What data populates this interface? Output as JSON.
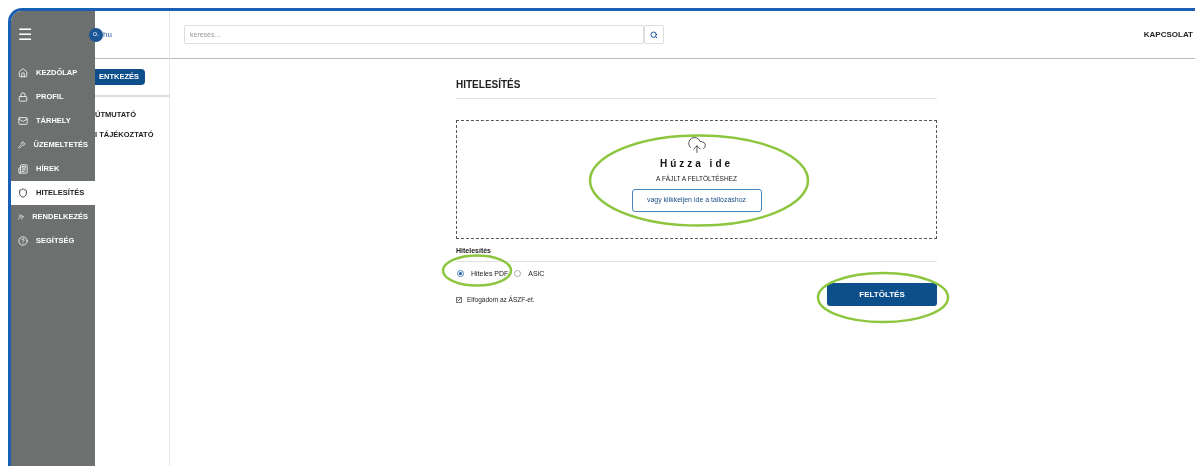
{
  "sidebar": {
    "menu_icon": "☰",
    "items": [
      {
        "label": "KEZDŐLAP",
        "selected": false
      },
      {
        "label": "PROFIL",
        "selected": false
      },
      {
        "label": "TÁRHELY",
        "selected": false
      },
      {
        "label": "ÜZEMELTETÉS",
        "selected": false
      },
      {
        "label": "HÍREK",
        "selected": false
      },
      {
        "label": "HITELESÍTÉS",
        "selected": true
      },
      {
        "label": "RENDELKEZÉS",
        "selected": false
      },
      {
        "label": "SEGÍTSÉG",
        "selected": false
      }
    ]
  },
  "left_panel": {
    "logo_mark": "o.",
    "logo_text": "hu",
    "login_button": "ENTKEZÉS",
    "links": [
      "ÚTMUTATÓ",
      "I TÁJÉKOZTATÓ"
    ]
  },
  "header": {
    "search": {
      "placeholder": "keresés..."
    },
    "contact_link": "KAPCSOLAT"
  },
  "page": {
    "title": "HITELESÍTÉS",
    "dropzone": {
      "title": "Húzza ide",
      "subtitle": "A FÁJLT A FELTÖLTÉSHEZ",
      "browse_button": "vagy klikkeljen ide a tallózáshoz"
    },
    "section_label": "Hitelesítés",
    "options": [
      {
        "label": "Hiteles PDF",
        "selected": true
      },
      {
        "label": "ASiC",
        "selected": false
      }
    ],
    "terms": {
      "label": "Elfogadom az ÁSZF-et.",
      "checked": true
    },
    "upload_button": "FELTÖLTÉS"
  }
}
